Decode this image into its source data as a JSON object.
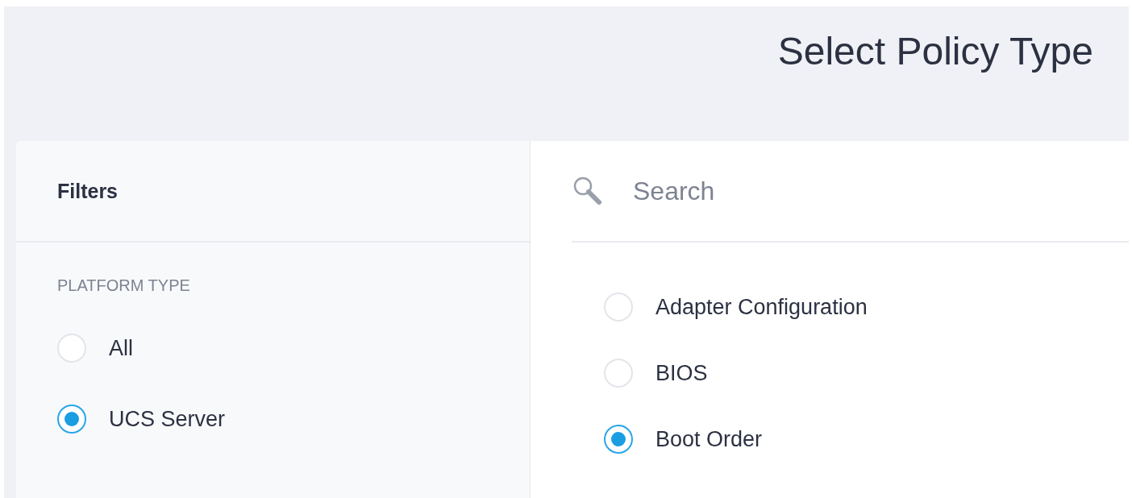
{
  "title": "Select Policy Type",
  "filters": {
    "heading": "Filters",
    "groups": [
      {
        "label": "PLATFORM TYPE",
        "options": [
          {
            "label": "All",
            "selected": false
          },
          {
            "label": "UCS Server",
            "selected": true
          }
        ]
      }
    ]
  },
  "search": {
    "placeholder": "Search"
  },
  "policy_types": [
    {
      "label": "Adapter Configuration",
      "selected": false
    },
    {
      "label": "BIOS",
      "selected": false
    },
    {
      "label": "Boot Order",
      "selected": true
    }
  ]
}
